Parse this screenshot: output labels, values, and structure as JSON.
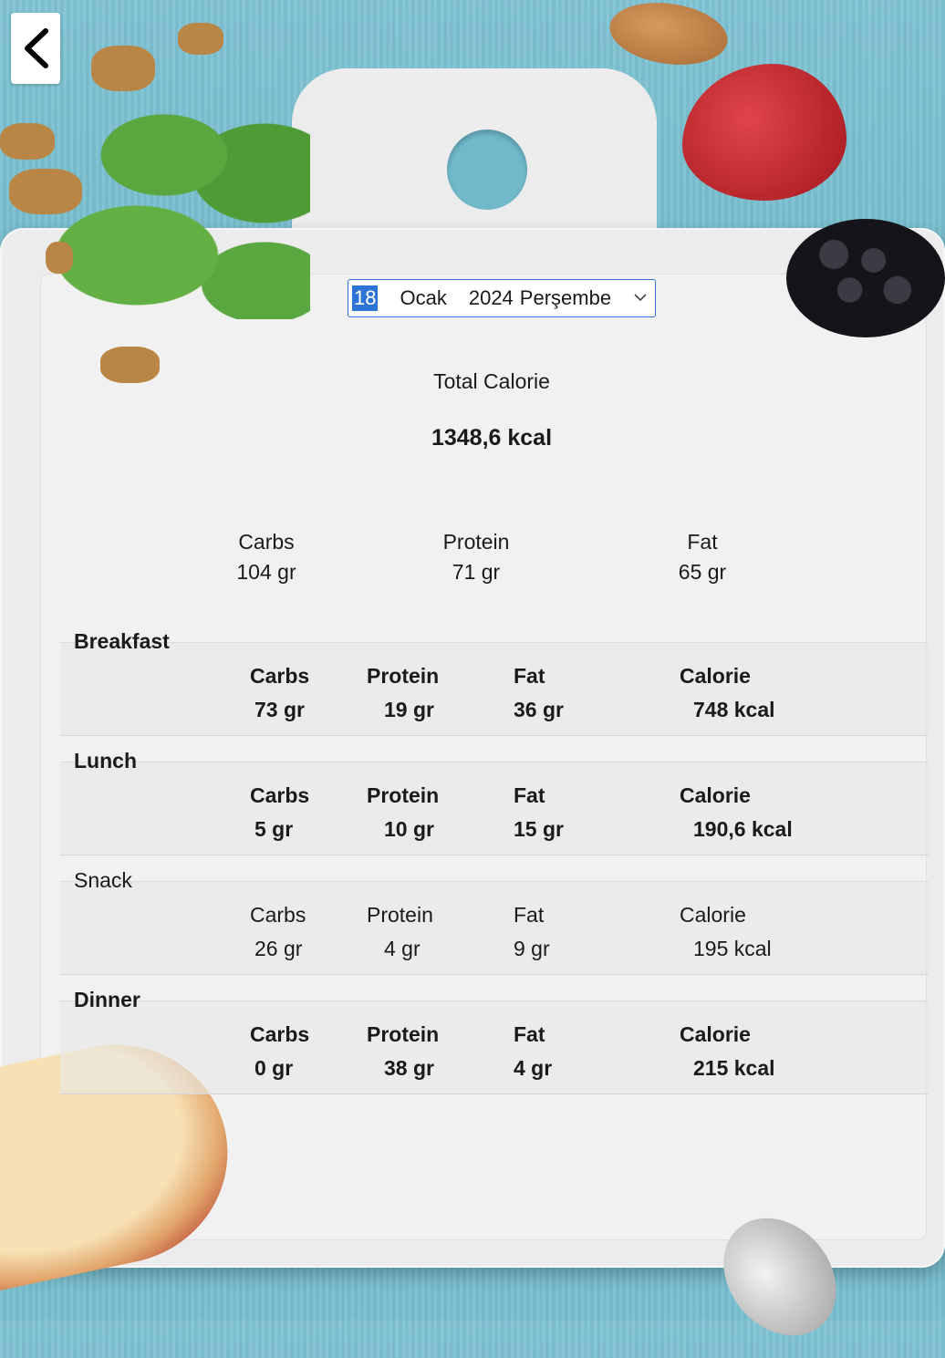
{
  "back_button": {
    "icon": "chevron-left-icon"
  },
  "date_picker": {
    "day": "18",
    "month": "Ocak",
    "year": "2024",
    "weekday": "Perşembe",
    "chevron": "chevron-down-icon"
  },
  "total": {
    "label": "Total Calorie",
    "value": "1348,6 kcal"
  },
  "macros": [
    {
      "label": "Carbs",
      "value": "104 gr"
    },
    {
      "label": "Protein",
      "value": "71 gr"
    },
    {
      "label": "Fat",
      "value": "65 gr"
    }
  ],
  "meals": [
    {
      "name": "Breakfast",
      "labels": [
        "Carbs",
        "Protein",
        "Fat",
        "Calorie"
      ],
      "values": [
        "73 gr",
        "19 gr",
        "36 gr",
        "748 kcal"
      ]
    },
    {
      "name": "Lunch",
      "labels": [
        "Carbs",
        "Protein",
        "Fat",
        "Calorie"
      ],
      "values": [
        "5 gr",
        "10 gr",
        "15 gr",
        "190,6 kcal"
      ]
    },
    {
      "name": "Snack",
      "labels": [
        "Carbs",
        "Protein",
        "Fat",
        "Calorie"
      ],
      "values": [
        "26 gr",
        "4 gr",
        "9 gr",
        "195 kcal"
      ]
    },
    {
      "name": "Dinner",
      "labels": [
        "Carbs",
        "Protein",
        "Fat",
        "Calorie"
      ],
      "values": [
        "0 gr",
        "38 gr",
        "4 gr",
        "215 kcal"
      ]
    }
  ],
  "colors": {
    "accent": "#2e73d6",
    "background": "#6db6c9",
    "board": "#ececec"
  }
}
